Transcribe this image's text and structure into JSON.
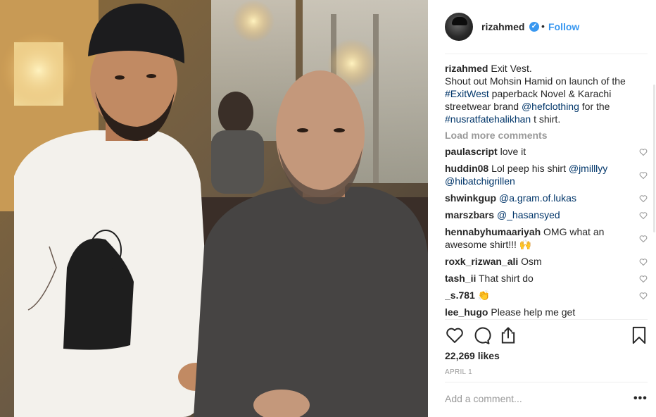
{
  "post": {
    "username": "rizahmed",
    "verified": true,
    "follow_label": "Follow",
    "dot": "•"
  },
  "caption": {
    "username": "rizahmed",
    "lines": [
      "Exit Vest.",
      "Shout out Mohsin Hamid on launch of the",
      "#ExitWest",
      " paperback Novel & Karachi",
      "streetwear brand ",
      "@hefclothing",
      " for the",
      "#nusratfatehalikhan",
      " t shirt."
    ]
  },
  "load_more": "Load more comments",
  "comments": [
    {
      "user": "paulascript",
      "text": "love it"
    },
    {
      "user": "huddin08",
      "text": "Lol peep his shirt ",
      "mention1": "@jmilllyy",
      "mention2": "@hibatchigrillen"
    },
    {
      "user": "shwinkgup",
      "mention": "@a.gram.of.lukas"
    },
    {
      "user": "marszbars",
      "mention": "@_hasansyed"
    },
    {
      "user": "hennabyhumaariyah",
      "text": "OMG what an",
      "text2": "awesome shirt!!! 🙌"
    },
    {
      "user": "roxk_rizwan_ali",
      "text": "Osm"
    },
    {
      "user": "tash_ii",
      "text": "That shirt do"
    },
    {
      "user": "_s.781",
      "text": "👏"
    },
    {
      "user": "lee_hugo",
      "text": "Please help me get"
    }
  ],
  "likes": "22,269 likes",
  "date": "APRIL 1",
  "add_comment_placeholder": "Add a comment...",
  "more_label": "•••",
  "icons": {
    "like": "heart-icon",
    "comment": "comment-icon",
    "share": "share-icon",
    "save": "bookmark-icon",
    "verified": "verified-badge-icon"
  },
  "colors": {
    "link": "#003569",
    "accent": "#3897f0",
    "muted": "#999999",
    "text": "#262626"
  }
}
